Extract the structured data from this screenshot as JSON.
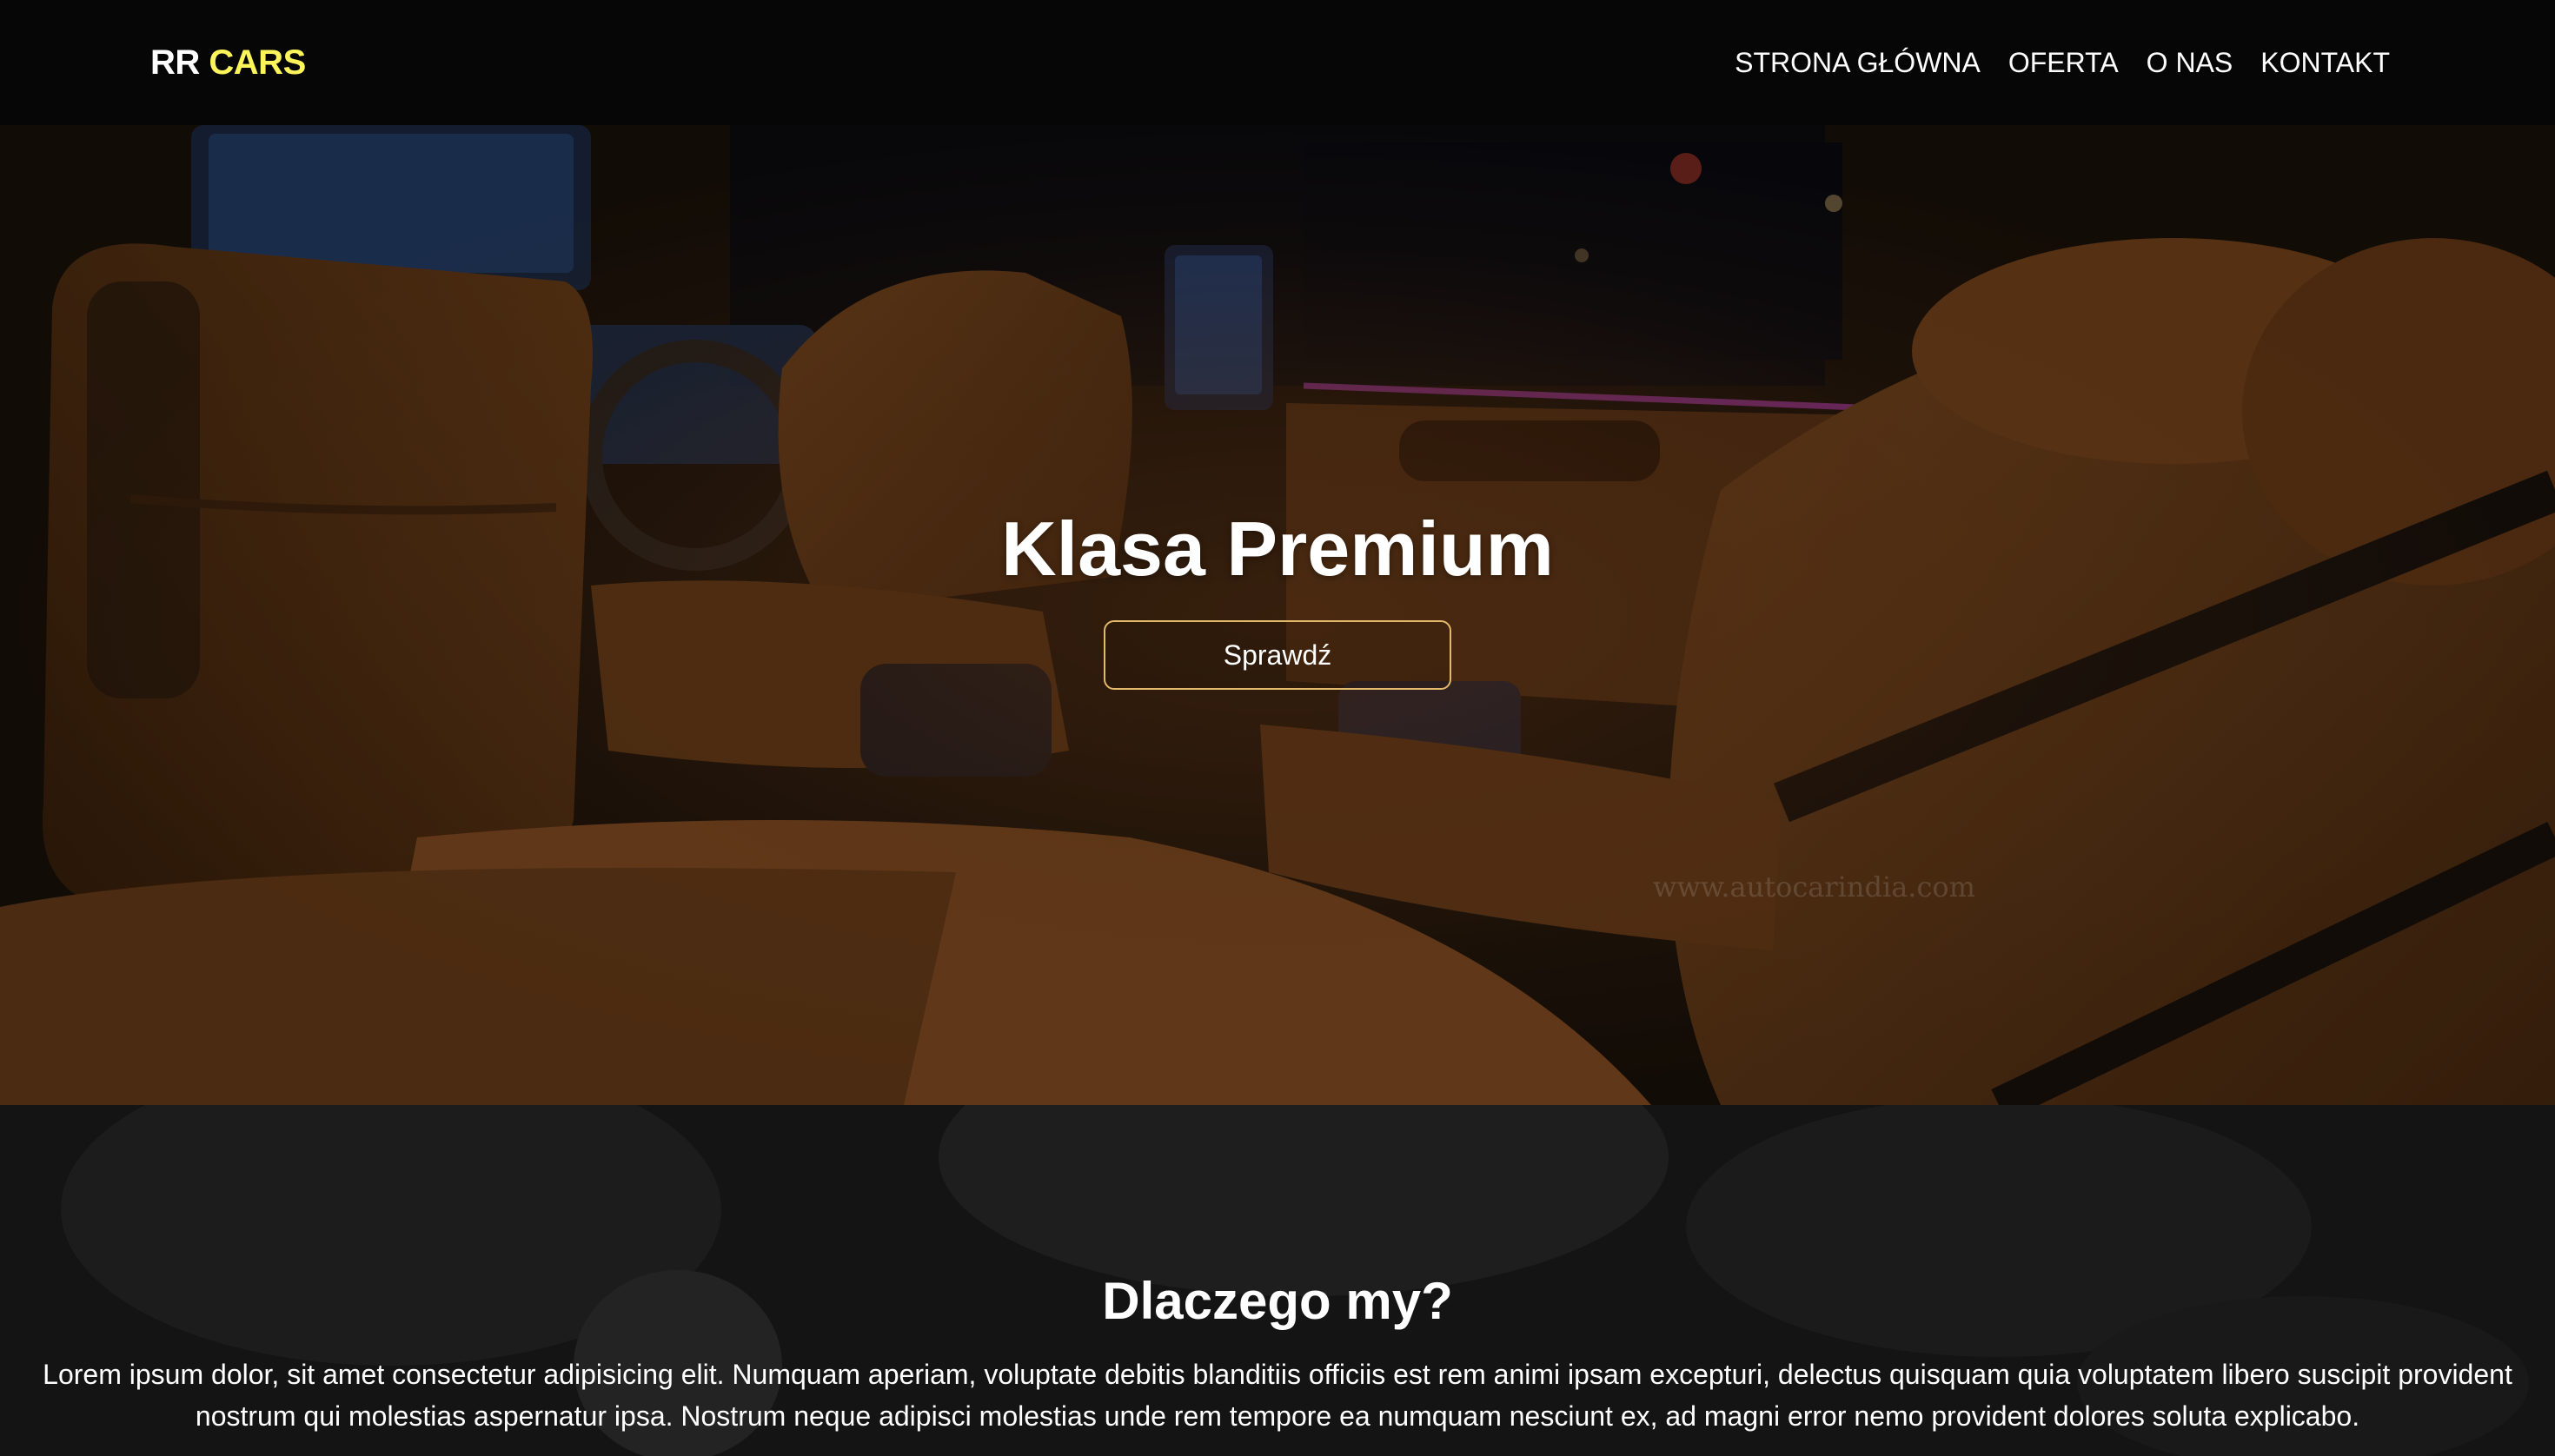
{
  "nav": {
    "logo_primary": "RR",
    "logo_accent": "CARS",
    "links": [
      "STRONA GŁÓWNA",
      "OFERTA",
      "O NAS",
      "KONTAKT"
    ]
  },
  "hero": {
    "title": "Klasa Premium",
    "button_label": "Sprawdź",
    "image_watermark": "www.autocarindia.com"
  },
  "why_us": {
    "title": "Dlaczego my?",
    "text": "Lorem ipsum dolor, sit amet consectetur adipisicing elit. Numquam aperiam, voluptate debitis blanditiis officiis est rem animi ipsam excepturi, delectus quisquam quia voluptatem libero suscipit provident nostrum qui molestias aspernatur ipsa. Nostrum neque adipisci molestias unde rem tempore ea numquam nesciunt ex, ad magni error nemo provident dolores soluta explicabo."
  },
  "colors": {
    "navbar_bg": "#060606",
    "logo_accent": "#fbf45a",
    "button_border": "#e3b96c",
    "section_bg": "#151515"
  }
}
